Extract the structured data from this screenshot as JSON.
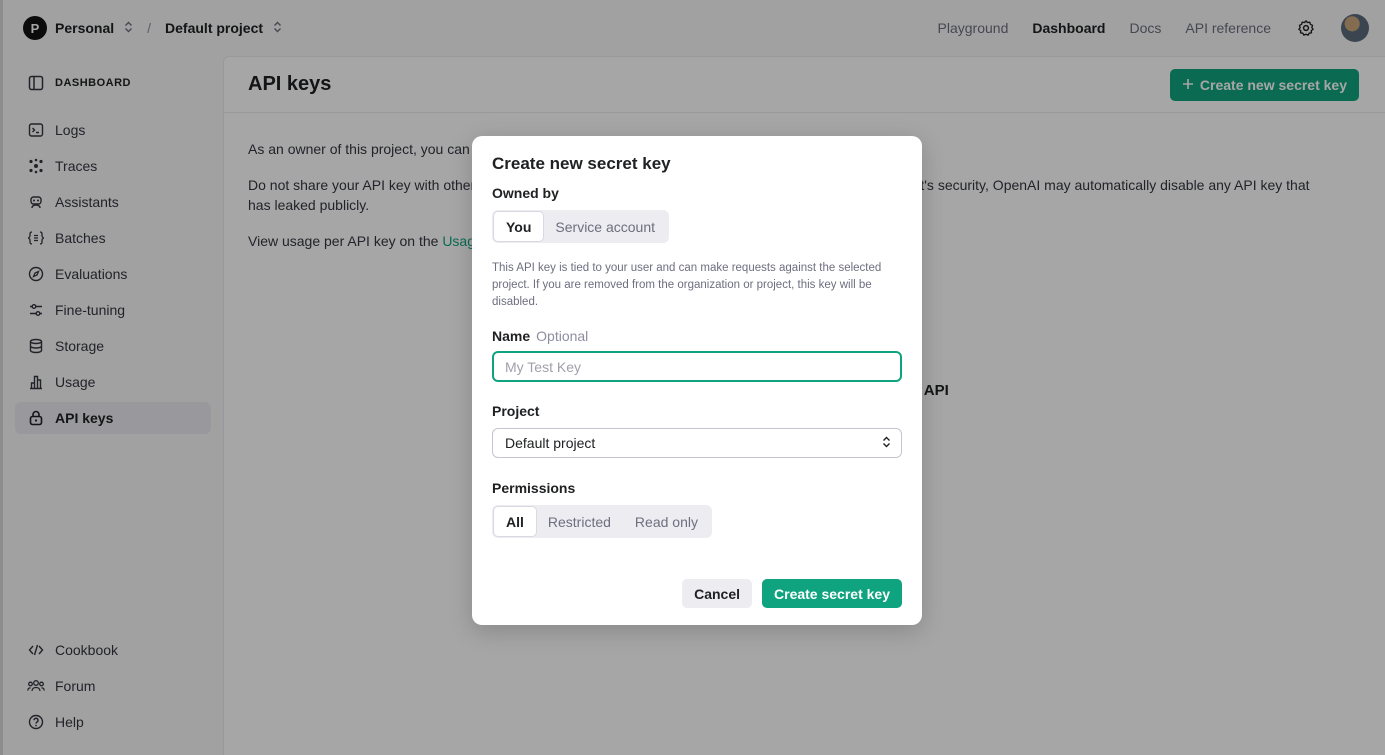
{
  "topbar": {
    "org_initial": "P",
    "org_name": "Personal",
    "project_name": "Default project",
    "nav": [
      "Playground",
      "Dashboard",
      "Docs",
      "API reference"
    ]
  },
  "sidebar": {
    "title": "DASHBOARD",
    "items": [
      {
        "label": "Logs",
        "icon": "terminal-icon"
      },
      {
        "label": "Traces",
        "icon": "traces-icon"
      },
      {
        "label": "Assistants",
        "icon": "robot-icon"
      },
      {
        "label": "Batches",
        "icon": "batches-icon"
      },
      {
        "label": "Evaluations",
        "icon": "compass-icon"
      },
      {
        "label": "Fine-tuning",
        "icon": "sliders-icon"
      },
      {
        "label": "Storage",
        "icon": "database-icon"
      },
      {
        "label": "Usage",
        "icon": "bar-chart-icon"
      },
      {
        "label": "API keys",
        "icon": "lock-icon"
      }
    ],
    "bottom_items": [
      {
        "label": "Cookbook",
        "icon": "code-icon"
      },
      {
        "label": "Forum",
        "icon": "users-icon"
      },
      {
        "label": "Help",
        "icon": "help-icon"
      }
    ]
  },
  "content": {
    "title": "API keys",
    "create_button": "Create new secret key",
    "p1": "As an owner of this project, you can v",
    "p2_left": "Do not share your API key with other",
    "p2_right": "ount's security, OpenAI may automatically disable any API key that",
    "p2_line2": "has leaked publicly.",
    "p3": "View usage per API key on the ",
    "p3_link": "Usage",
    "behind_text": "I API"
  },
  "modal": {
    "title": "Create new secret key",
    "owned_by_label": "Owned by",
    "owned_by_options": [
      "You",
      "Service account"
    ],
    "owned_by_help": "This API key is tied to your user and can make requests against the selected project. If you are removed from the organization or project, this key will be disabled.",
    "name_label": "Name",
    "name_optional": "Optional",
    "name_placeholder": "My Test Key",
    "project_label": "Project",
    "project_value": "Default project",
    "permissions_label": "Permissions",
    "permissions_options": [
      "All",
      "Restricted",
      "Read only"
    ],
    "cancel_label": "Cancel",
    "create_label": "Create secret key"
  },
  "colors": {
    "accent": "#10a37f",
    "overlay": "rgba(0,0,0,0.35)"
  }
}
